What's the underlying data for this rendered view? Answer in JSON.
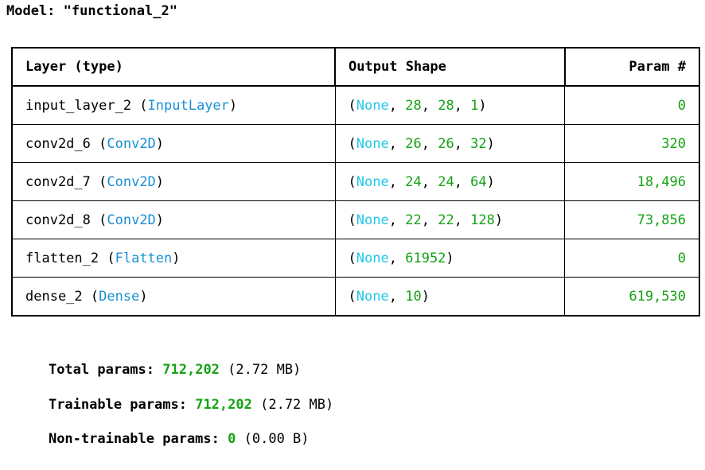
{
  "model": {
    "title": "Model: \"functional_2\""
  },
  "table": {
    "headers": {
      "layer": "Layer (type)",
      "output_shape": "Output Shape",
      "params": "Param #"
    },
    "rows": [
      {
        "name": "input_layer_2",
        "type": "InputLayer",
        "shape": [
          "None",
          "28",
          "28",
          "1"
        ],
        "params": "0"
      },
      {
        "name": "conv2d_6",
        "type": "Conv2D",
        "shape": [
          "None",
          "26",
          "26",
          "32"
        ],
        "params": "320"
      },
      {
        "name": "conv2d_7",
        "type": "Conv2D",
        "shape": [
          "None",
          "24",
          "24",
          "64"
        ],
        "params": "18,496"
      },
      {
        "name": "conv2d_8",
        "type": "Conv2D",
        "shape": [
          "None",
          "22",
          "22",
          "128"
        ],
        "params": "73,856"
      },
      {
        "name": "flatten_2",
        "type": "Flatten",
        "shape": [
          "None",
          "61952"
        ],
        "params": "0"
      },
      {
        "name": "dense_2",
        "type": "Dense",
        "shape": [
          "None",
          "10"
        ],
        "params": "619,530"
      }
    ]
  },
  "totals": [
    {
      "label": "Total params:",
      "value": "712,202",
      "size": "(2.72 MB)"
    },
    {
      "label": "Trainable params:",
      "value": "712,202",
      "size": "(2.72 MB)"
    },
    {
      "label": "Non-trainable params:",
      "value": "0",
      "size": "(0.00 B)"
    }
  ],
  "colors": {
    "class_name": "#1a8fd6",
    "none_keyword": "#1ec8e8",
    "number": "#14a314"
  }
}
